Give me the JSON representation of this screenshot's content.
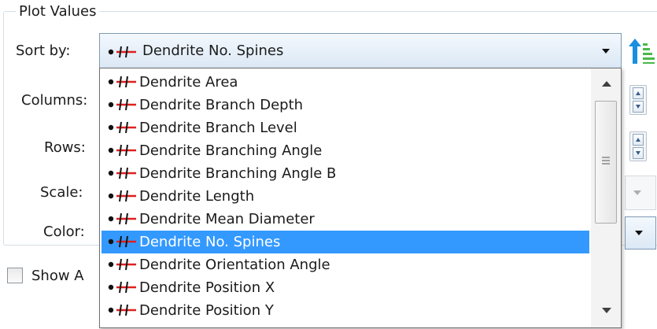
{
  "group": {
    "title": "Plot Values"
  },
  "labels": {
    "sort_by": "Sort by:",
    "columns": "Columns:",
    "rows": "Rows:",
    "scale": "Scale:",
    "color": "Color:"
  },
  "sort_combo": {
    "value": "Dendrite No. Spines",
    "icon": "dendrite-icon"
  },
  "checkbox": {
    "label": "Show A",
    "checked": false
  },
  "dropdown": {
    "selected_index": 7,
    "items": [
      {
        "label": "Dendrite Area"
      },
      {
        "label": "Dendrite Branch Depth"
      },
      {
        "label": "Dendrite Branch Level"
      },
      {
        "label": "Dendrite Branching Angle"
      },
      {
        "label": "Dendrite Branching Angle B"
      },
      {
        "label": "Dendrite Length"
      },
      {
        "label": "Dendrite Mean Diameter"
      },
      {
        "label": "Dendrite No. Spines"
      },
      {
        "label": "Dendrite Orientation Angle"
      },
      {
        "label": "Dendrite Position X"
      },
      {
        "label": "Dendrite Position Y"
      }
    ]
  },
  "colors": {
    "selection": "#3399ff",
    "icon_red": "#e02020",
    "sort_arrow": "#1a8fe0",
    "sort_bars": "#49b949"
  }
}
